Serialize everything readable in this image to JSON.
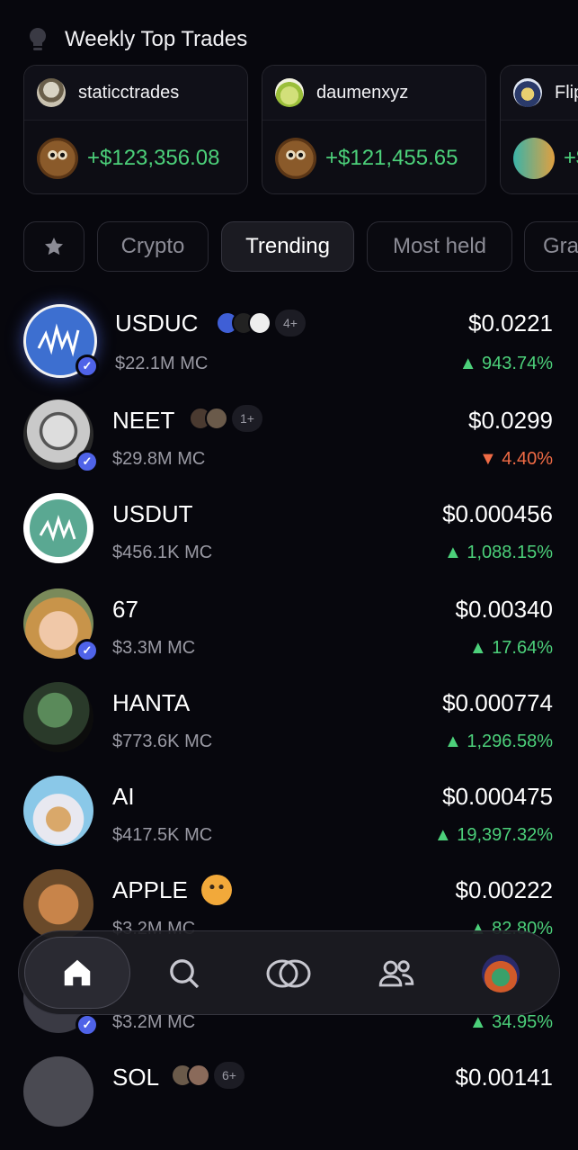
{
  "header": {
    "title": "Weekly Top Trades"
  },
  "trades": [
    {
      "user": "staticctrades",
      "profit": "+$123,356.08"
    },
    {
      "user": "daumenxyz",
      "profit": "+$121,455.65"
    },
    {
      "user": "Flip",
      "profit": "+$"
    }
  ],
  "filters": [
    "Crypto",
    "Trending",
    "Most held",
    "Gra"
  ],
  "tokens": [
    {
      "name": "USDUC",
      "mc": "$22.1M MC",
      "price": "$0.0221",
      "change": "▲ 943.74%",
      "holders": "4+"
    },
    {
      "name": "NEET",
      "mc": "$29.8M MC",
      "price": "$0.0299",
      "change": "▼ 4.40%",
      "holders": "1+"
    },
    {
      "name": "USDUT",
      "mc": "$456.1K MC",
      "price": "$0.000456",
      "change": "▲ 1,088.15%"
    },
    {
      "name": "67",
      "mc": "$3.3M MC",
      "price": "$0.00340",
      "change": "▲ 17.64%"
    },
    {
      "name": "HANTA",
      "mc": "$773.6K MC",
      "price": "$0.000774",
      "change": "▲ 1,296.58%"
    },
    {
      "name": "AI",
      "mc": "$417.5K MC",
      "price": "$0.000475",
      "change": "▲ 19,397.32%"
    },
    {
      "name": "APPLE",
      "mc": "$3.2M MC",
      "price": "$0.00222",
      "change": "▲ 82.80%"
    },
    {
      "name": "",
      "mc": "$3.2M MC",
      "price": "",
      "change": "▲ 34.95%"
    },
    {
      "name": "SOL",
      "mc": "",
      "price": "$0.00141",
      "change": "",
      "holders": "6+"
    }
  ],
  "nav": [
    "home-icon",
    "search-icon",
    "coins-icon",
    "people-icon",
    "profile-avatar"
  ],
  "colors": {
    "positive": "#4cd07a",
    "negative": "#f06b45",
    "verified": "#4f63e8"
  }
}
